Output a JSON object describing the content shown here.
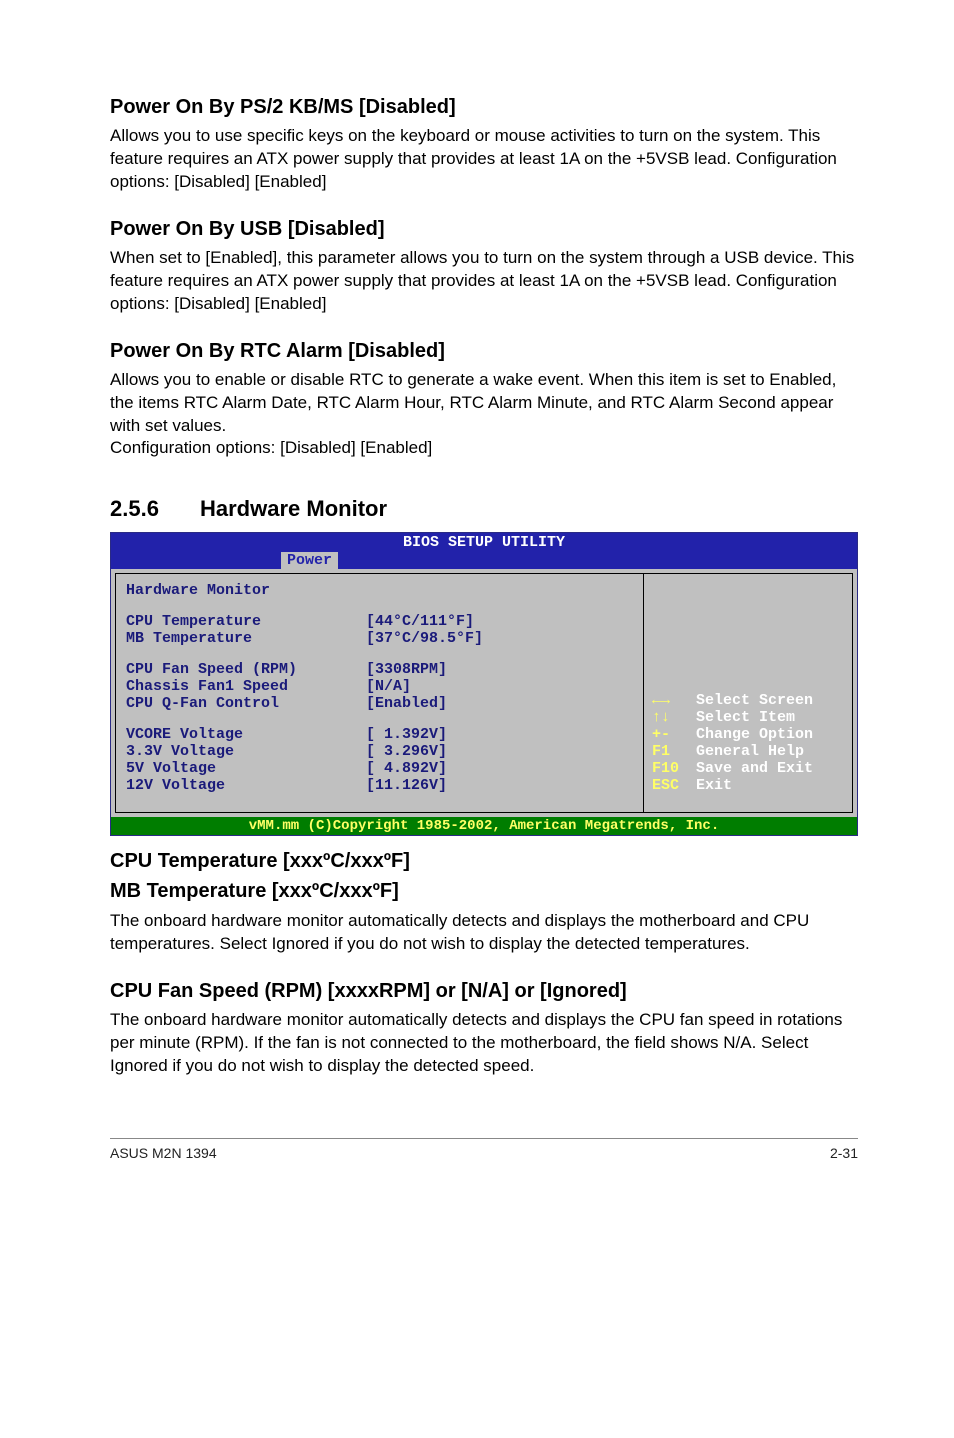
{
  "s1": {
    "title": "Power On By PS/2 KB/MS [Disabled]",
    "body": "Allows you to use specific keys on the keyboard or mouse activities to turn on the system. This feature requires an ATX power supply that provides at least 1A on the +5VSB lead. Configuration options: [Disabled] [Enabled]"
  },
  "s2": {
    "title": "Power On By USB [Disabled]",
    "body": "When set to [Enabled], this parameter allows you to turn on the system through a USB device. This feature requires an ATX power supply that provides at least 1A on the +5VSB lead. Configuration options: [Disabled] [Enabled]"
  },
  "s3": {
    "title": "Power On By RTC Alarm [Disabled]",
    "body": "Allows you to enable or disable RTC to generate a wake event. When this item is set to Enabled, the items RTC Alarm Date, RTC Alarm Hour, RTC Alarm Minute, and RTC Alarm Second appear with set values.\nConfiguration options: [Disabled] [Enabled]"
  },
  "section": {
    "num": "2.5.6",
    "title": "Hardware Monitor"
  },
  "bios": {
    "title": "BIOS SETUP UTILITY",
    "tab": "Power",
    "header": "Hardware Monitor",
    "rows": [
      {
        "label": "CPU Temperature",
        "value": "[44°C/111°F]"
      },
      {
        "label": "MB Temperature",
        "value": "[37°C/98.5°F]"
      }
    ],
    "rows2": [
      {
        "label": "CPU Fan Speed (RPM)",
        "value": "[3308RPM]"
      },
      {
        "label": "Chassis Fan1 Speed",
        "value": "[N/A]"
      },
      {
        "label": "CPU Q-Fan Control",
        "value": "[Enabled]"
      }
    ],
    "rows3": [
      {
        "label": "VCORE Voltage",
        "value": "[ 1.392V]"
      },
      {
        "label": "3.3V Voltage",
        "value": "[ 3.296V]"
      },
      {
        "label": "5V Voltage",
        "value": "[ 4.892V]"
      },
      {
        "label": "12V Voltage",
        "value": "[11.126V]"
      }
    ],
    "hints": [
      {
        "key": "←→",
        "txt": "Select Screen"
      },
      {
        "key": "↑↓",
        "txt": "Select Item"
      },
      {
        "key": "+-",
        "txt": "Change Option"
      },
      {
        "key": "F1",
        "txt": "General Help"
      },
      {
        "key": "F10",
        "txt": "Save and Exit"
      },
      {
        "key": "ESC",
        "txt": "Exit"
      }
    ],
    "copyright": "vMM.mm (C)Copyright 1985-2002, American Megatrends, Inc."
  },
  "sub1": {
    "line1": "CPU Temperature [xxxºC/xxxºF]",
    "line2": "MB Temperature [xxxºC/xxxºF]",
    "body": "The onboard hardware monitor automatically detects and displays the motherboard and CPU temperatures. Select Ignored if you do not wish to display the detected temperatures."
  },
  "sub2": {
    "title": "CPU Fan Speed (RPM) [xxxxRPM] or [N/A] or [Ignored]",
    "body": "The onboard hardware monitor automatically detects and displays the CPU fan speed in rotations per minute (RPM). If the fan is not connected to the motherboard, the field shows N/A. Select Ignored if you do not wish to display the detected speed."
  },
  "footer": {
    "left": "ASUS M2N 1394",
    "right": "2-31"
  }
}
